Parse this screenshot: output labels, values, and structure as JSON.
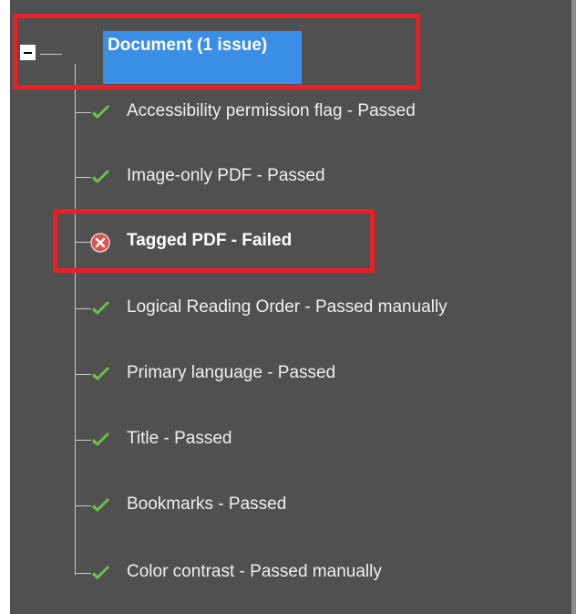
{
  "tree": {
    "root": {
      "label": "Document (1 issue)",
      "expanded": true
    },
    "items": [
      {
        "label": "Accessibility permission flag - Passed",
        "status": "passed",
        "icon": "check-icon"
      },
      {
        "label": "Image-only PDF - Passed",
        "status": "passed",
        "icon": "check-icon"
      },
      {
        "label": "Tagged PDF - Failed",
        "status": "failed",
        "icon": "error-icon"
      },
      {
        "label": "Logical Reading Order - Passed manually",
        "status": "passed",
        "icon": "check-icon"
      },
      {
        "label": "Primary language - Passed",
        "status": "passed",
        "icon": "check-icon"
      },
      {
        "label": "Title - Passed",
        "status": "passed",
        "icon": "check-icon"
      },
      {
        "label": "Bookmarks - Passed",
        "status": "passed",
        "icon": "check-icon"
      },
      {
        "label": "Color contrast - Passed manually",
        "status": "passed",
        "icon": "check-icon"
      }
    ]
  },
  "colors": {
    "background": "#505050",
    "selection": "#3a8ee6",
    "highlight": "#e8202a",
    "check": "#6cc24a",
    "error": "#d9534f"
  }
}
